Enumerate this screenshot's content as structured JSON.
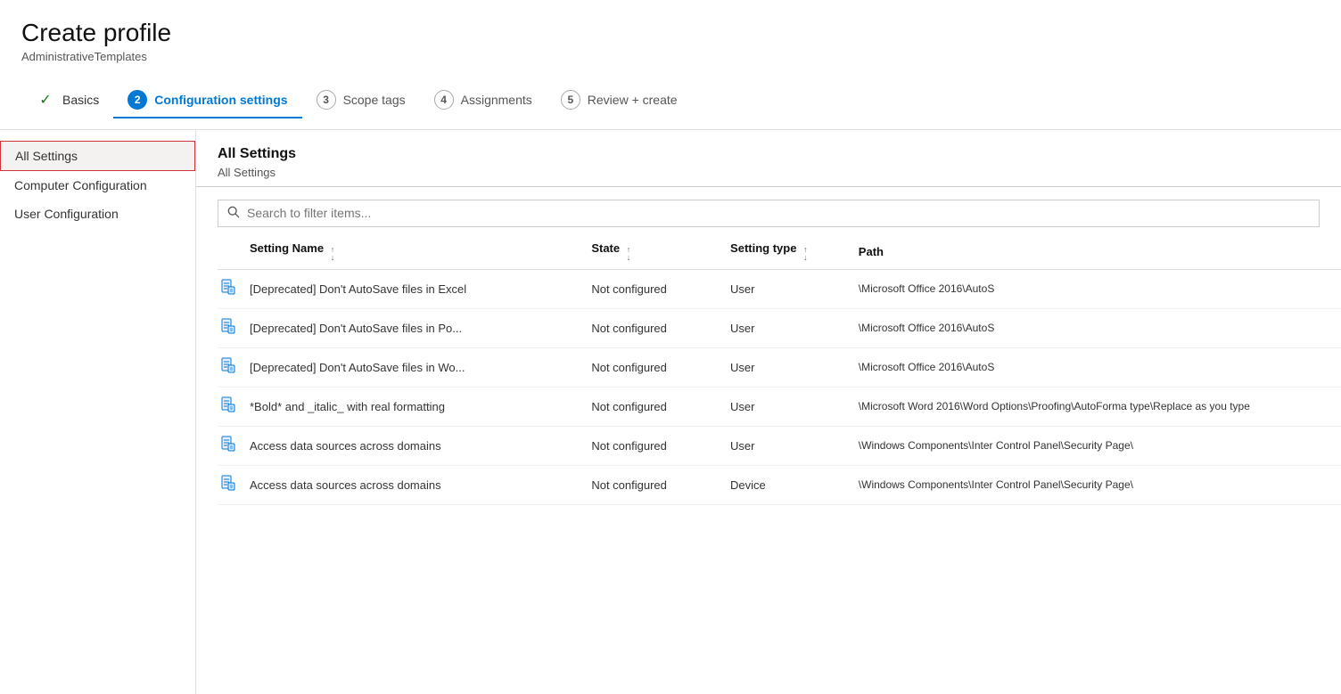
{
  "header": {
    "title": "Create profile",
    "subtitle": "AdministrativeTemplates"
  },
  "wizard": {
    "tabs": [
      {
        "id": "basics",
        "state": "completed",
        "number": "",
        "checkmark": "✓",
        "label": "Basics"
      },
      {
        "id": "configuration",
        "state": "active",
        "number": "2",
        "label": "Configuration settings"
      },
      {
        "id": "scope",
        "state": "inactive",
        "number": "3",
        "label": "Scope tags"
      },
      {
        "id": "assignments",
        "state": "inactive",
        "number": "4",
        "label": "Assignments"
      },
      {
        "id": "review",
        "state": "inactive",
        "number": "5",
        "label": "Review + create"
      }
    ]
  },
  "sidebar": {
    "items": [
      {
        "id": "all-settings",
        "label": "All Settings",
        "active": true
      },
      {
        "id": "computer-config",
        "label": "Computer Configuration",
        "active": false
      },
      {
        "id": "user-config",
        "label": "User Configuration",
        "active": false
      }
    ]
  },
  "content": {
    "title": "All Settings",
    "breadcrumb": "All Settings",
    "search": {
      "placeholder": "Search to filter items..."
    },
    "table": {
      "columns": [
        {
          "id": "icon",
          "label": ""
        },
        {
          "id": "name",
          "label": "Setting Name",
          "sortable": true
        },
        {
          "id": "state",
          "label": "State",
          "sortable": true
        },
        {
          "id": "type",
          "label": "Setting type",
          "sortable": true
        },
        {
          "id": "path",
          "label": "Path",
          "sortable": false
        }
      ],
      "rows": [
        {
          "icon": "📄",
          "name": "[Deprecated] Don't AutoSave files in Excel",
          "state": "Not configured",
          "type": "User",
          "path": "\\Microsoft Office 2016\\AutoS"
        },
        {
          "icon": "📄",
          "name": "[Deprecated] Don't AutoSave files in Po...",
          "state": "Not configured",
          "type": "User",
          "path": "\\Microsoft Office 2016\\AutoS"
        },
        {
          "icon": "📄",
          "name": "[Deprecated] Don't AutoSave files in Wo...",
          "state": "Not configured",
          "type": "User",
          "path": "\\Microsoft Office 2016\\AutoS"
        },
        {
          "icon": "📄",
          "name": "*Bold* and _italic_ with real formatting",
          "state": "Not configured",
          "type": "User",
          "path": "\\Microsoft Word 2016\\Word Options\\Proofing\\AutoForma type\\Replace as you type"
        },
        {
          "icon": "📄",
          "name": "Access data sources across domains",
          "state": "Not configured",
          "type": "User",
          "path": "\\Windows Components\\Inter Control Panel\\Security Page\\"
        },
        {
          "icon": "📄",
          "name": "Access data sources across domains",
          "state": "Not configured",
          "type": "Device",
          "path": "\\Windows Components\\Inter Control Panel\\Security Page\\"
        }
      ]
    }
  }
}
